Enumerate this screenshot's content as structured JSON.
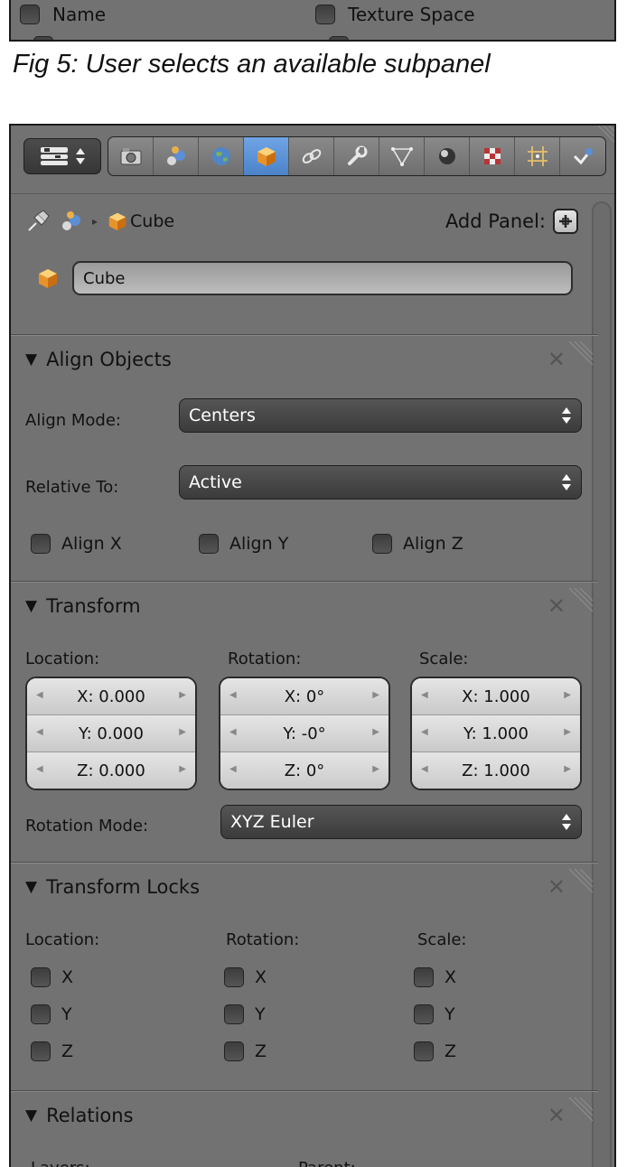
{
  "top_panel": {
    "checkboxes": [
      {
        "label": "Name",
        "checked": false
      },
      {
        "label": "Texture Space",
        "checked": false
      }
    ]
  },
  "caption": "Fig 5: User selects an available subpanel",
  "header": {
    "editor_type_icon": "properties-editor-icon",
    "tabs": [
      {
        "icon": "camera-render-icon",
        "active": false
      },
      {
        "icon": "render-layers-icon",
        "active": false
      },
      {
        "icon": "world-globe-icon",
        "active": false
      },
      {
        "icon": "object-cube-icon",
        "active": true
      },
      {
        "icon": "constraints-link-icon",
        "active": false
      },
      {
        "icon": "modifier-wrench-icon",
        "active": false
      },
      {
        "icon": "mesh-data-icon",
        "active": false
      },
      {
        "icon": "material-sphere-icon",
        "active": false
      },
      {
        "icon": "texture-checker-icon",
        "active": false
      },
      {
        "icon": "particles-icon",
        "active": false
      },
      {
        "icon": "physics-icon",
        "active": false
      }
    ]
  },
  "breadcrumb": {
    "object_name": "Cube"
  },
  "add_panel_label": "Add Panel:",
  "object_name_field": "Cube",
  "align_objects": {
    "title": "Align Objects",
    "align_mode_label": "Align Mode:",
    "align_mode_value": "Centers",
    "relative_to_label": "Relative To:",
    "relative_to_value": "Active",
    "checks": [
      "Align X",
      "Align Y",
      "Align Z"
    ]
  },
  "transform": {
    "title": "Transform",
    "location_label": "Location:",
    "rotation_label": "Rotation:",
    "scale_label": "Scale:",
    "location": [
      "X: 0.000",
      "Y: 0.000",
      "Z: 0.000"
    ],
    "rotation": [
      "X: 0°",
      "Y: -0°",
      "Z: 0°"
    ],
    "scale": [
      "X: 1.000",
      "Y: 1.000",
      "Z: 1.000"
    ],
    "rotation_mode_label": "Rotation Mode:",
    "rotation_mode_value": "XYZ Euler"
  },
  "transform_locks": {
    "title": "Transform Locks",
    "location_label": "Location:",
    "rotation_label": "Rotation:",
    "scale_label": "Scale:",
    "axes": [
      "X",
      "Y",
      "Z"
    ]
  },
  "relations": {
    "title": "Relations",
    "layers_label": "Layers:",
    "parent_label": "Parent:"
  }
}
